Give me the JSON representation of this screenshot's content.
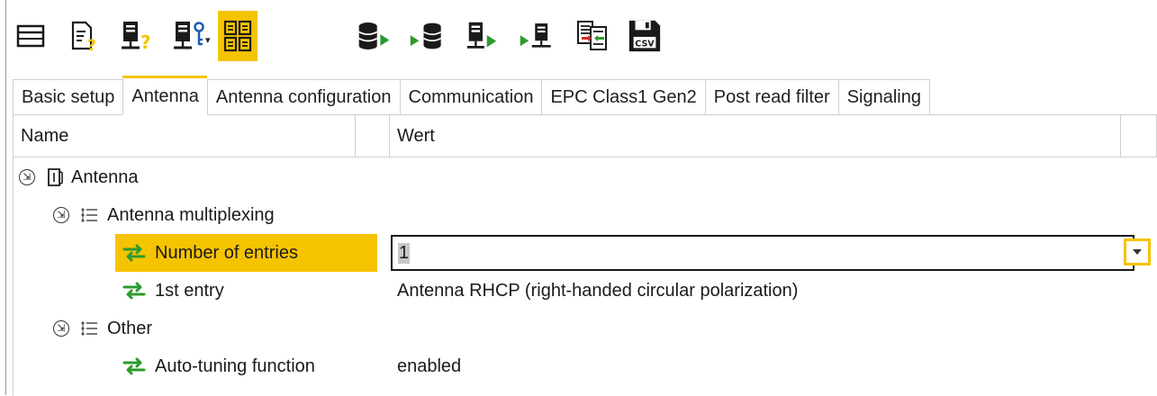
{
  "toolbar": {
    "buttons": [
      {
        "icon": "window-icon"
      },
      {
        "icon": "document-help-icon"
      },
      {
        "icon": "device-help-icon"
      },
      {
        "icon": "device-key-icon",
        "has_dropdown": true
      },
      {
        "icon": "grid-view-icon",
        "active": true
      },
      {
        "icon": "database-export-icon"
      },
      {
        "icon": "database-import-icon"
      },
      {
        "icon": "device-export-icon"
      },
      {
        "icon": "device-import-icon"
      },
      {
        "icon": "compare-documents-icon"
      },
      {
        "icon": "save-csv-icon",
        "text": "CSV"
      }
    ],
    "dropdown_glyph": "▾"
  },
  "tabs": [
    {
      "label": "Basic setup",
      "active": false
    },
    {
      "label": "Antenna",
      "active": true
    },
    {
      "label": "Antenna configuration",
      "active": false
    },
    {
      "label": "Communication",
      "active": false
    },
    {
      "label": "EPC Class1 Gen2",
      "active": false
    },
    {
      "label": "Post read filter",
      "active": false
    },
    {
      "label": "Signaling",
      "active": false
    }
  ],
  "grid": {
    "col_name": "Name",
    "col_value": "Wert",
    "rows": [
      {
        "label": "Antenna",
        "value": ""
      },
      {
        "label": "Antenna multiplexing",
        "value": ""
      },
      {
        "label": "Number of entries",
        "value": "1"
      },
      {
        "label": "1st entry",
        "value": "Antenna RHCP (right-handed circular polarization)"
      },
      {
        "label": "Other",
        "value": ""
      },
      {
        "label": "Auto-tuning function",
        "value": "enabled"
      }
    ],
    "collapse_glyph": "⇲"
  },
  "colors": {
    "accent": "#f5c400",
    "green": "#2e9a2e",
    "border": "#cfcfcf"
  }
}
